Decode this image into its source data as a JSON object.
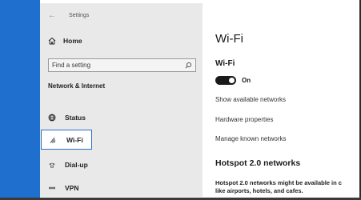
{
  "window": {
    "title": "Settings",
    "back_glyph": "←"
  },
  "sidebar": {
    "home_label": "Home",
    "search_placeholder": "Find a setting",
    "section_heading": "Network & Internet",
    "items": [
      {
        "label": "Status",
        "icon": "globe-icon"
      },
      {
        "label": "Wi-Fi",
        "icon": "wifi-icon",
        "selected": true
      },
      {
        "label": "Dial-up",
        "icon": "phone-icon"
      },
      {
        "label": "VPN",
        "icon": "vpn-icon"
      }
    ]
  },
  "main": {
    "title": "Wi-Fi",
    "wifi_heading": "Wi-Fi",
    "toggle_state": "On",
    "toggle_on": true,
    "links": [
      "Show available networks",
      "Hardware properties",
      "Manage known networks"
    ],
    "hotspot_heading": "Hotspot 2.0 networks",
    "hotspot_body_line1": "Hotspot 2.0 networks might be available in c",
    "hotspot_body_line2": "like airports, hotels, and cafes."
  },
  "colors": {
    "accent": "#1f6fcf",
    "sidebar_bg": "#e9e9e9",
    "selected_border": "#2a6fc7"
  }
}
